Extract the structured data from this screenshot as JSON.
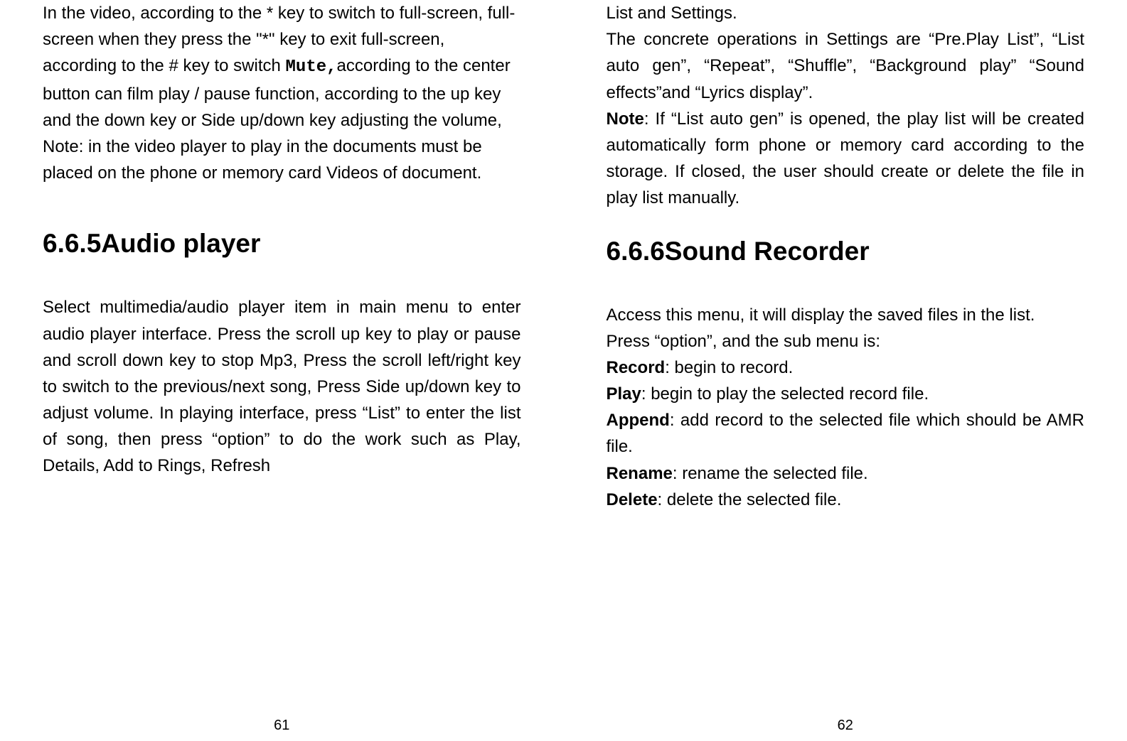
{
  "leftPage": {
    "para1_pre": "In the video, according to the * key to switch to full-screen, full-screen when they press the \"*\" key to exit full-screen, according to the # key to switch ",
    "para1_mono": "Mute,",
    "para1_post": "according to the center button can film play / pause function, according to the up key and the down key or Side up/down key adjusting the volume, Note: in the video player to play in the documents must be placed on the phone or memory card Videos of document.",
    "heading": "6.6.5Audio player",
    "para2": "Select multimedia/audio player item in main menu to enter audio player interface. Press the scroll up key to play or pause and scroll down key to stop Mp3, Press the scroll left/right key to switch to the previous/next song, Press Side up/down key to adjust volume. In playing interface, press “List” to enter the list of song, then press “option” to do the work such as Play, Details, Add to Rings, Refresh",
    "pageNumber": "61"
  },
  "rightPage": {
    "para1": "List and Settings.",
    "para2": "The concrete operations in Settings are “Pre.Play List”, “List auto gen”, “Repeat”, “Shuffle”, “Background play” “Sound effects”and “Lyrics display”.",
    "para3_bold": "Note",
    "para3_rest": ": If “List auto gen” is opened, the play list will be created automatically form phone or memory card according to the storage. If closed, the user should create or delete the file in play list manually.",
    "heading": "6.6.6Sound Recorder",
    "para4": "Access this menu, it will display the saved files in the list.",
    "para5": "Press “option”, and the sub menu is:",
    "record_bold": "Record",
    "record_rest": ": begin to record.",
    "play_bold": "Play",
    "play_rest": ": begin to play the selected record file.",
    "append_bold": "Append",
    "append_rest": ": add record to the selected file which should be AMR file.",
    "rename_bold": "Rename",
    "rename_rest": ": rename the selected file.",
    "delete_bold": "Delete",
    "delete_rest": ": delete the selected file.",
    "pageNumber": "62"
  }
}
